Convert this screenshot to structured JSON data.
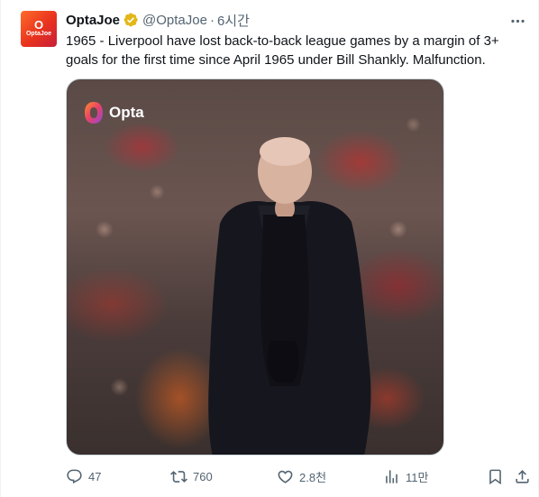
{
  "author": {
    "name": "OptaJoe",
    "handle": "@OptaJoe",
    "separator": "·",
    "time": "6시간",
    "avatar_letter": "O",
    "avatar_text": "OptaJoe"
  },
  "tweet": {
    "text": "1965 - Liverpool have lost back-to-back league games by a margin of 3+ goals for the first time since April 1965 under Bill Shankly. Malfunction."
  },
  "media": {
    "logo_text": "Opta"
  },
  "actions": {
    "replies": "47",
    "retweets": "760",
    "likes": "2.8천",
    "views": "11만"
  },
  "colors": {
    "secondary": "#536471",
    "verified": "#e2b719"
  }
}
